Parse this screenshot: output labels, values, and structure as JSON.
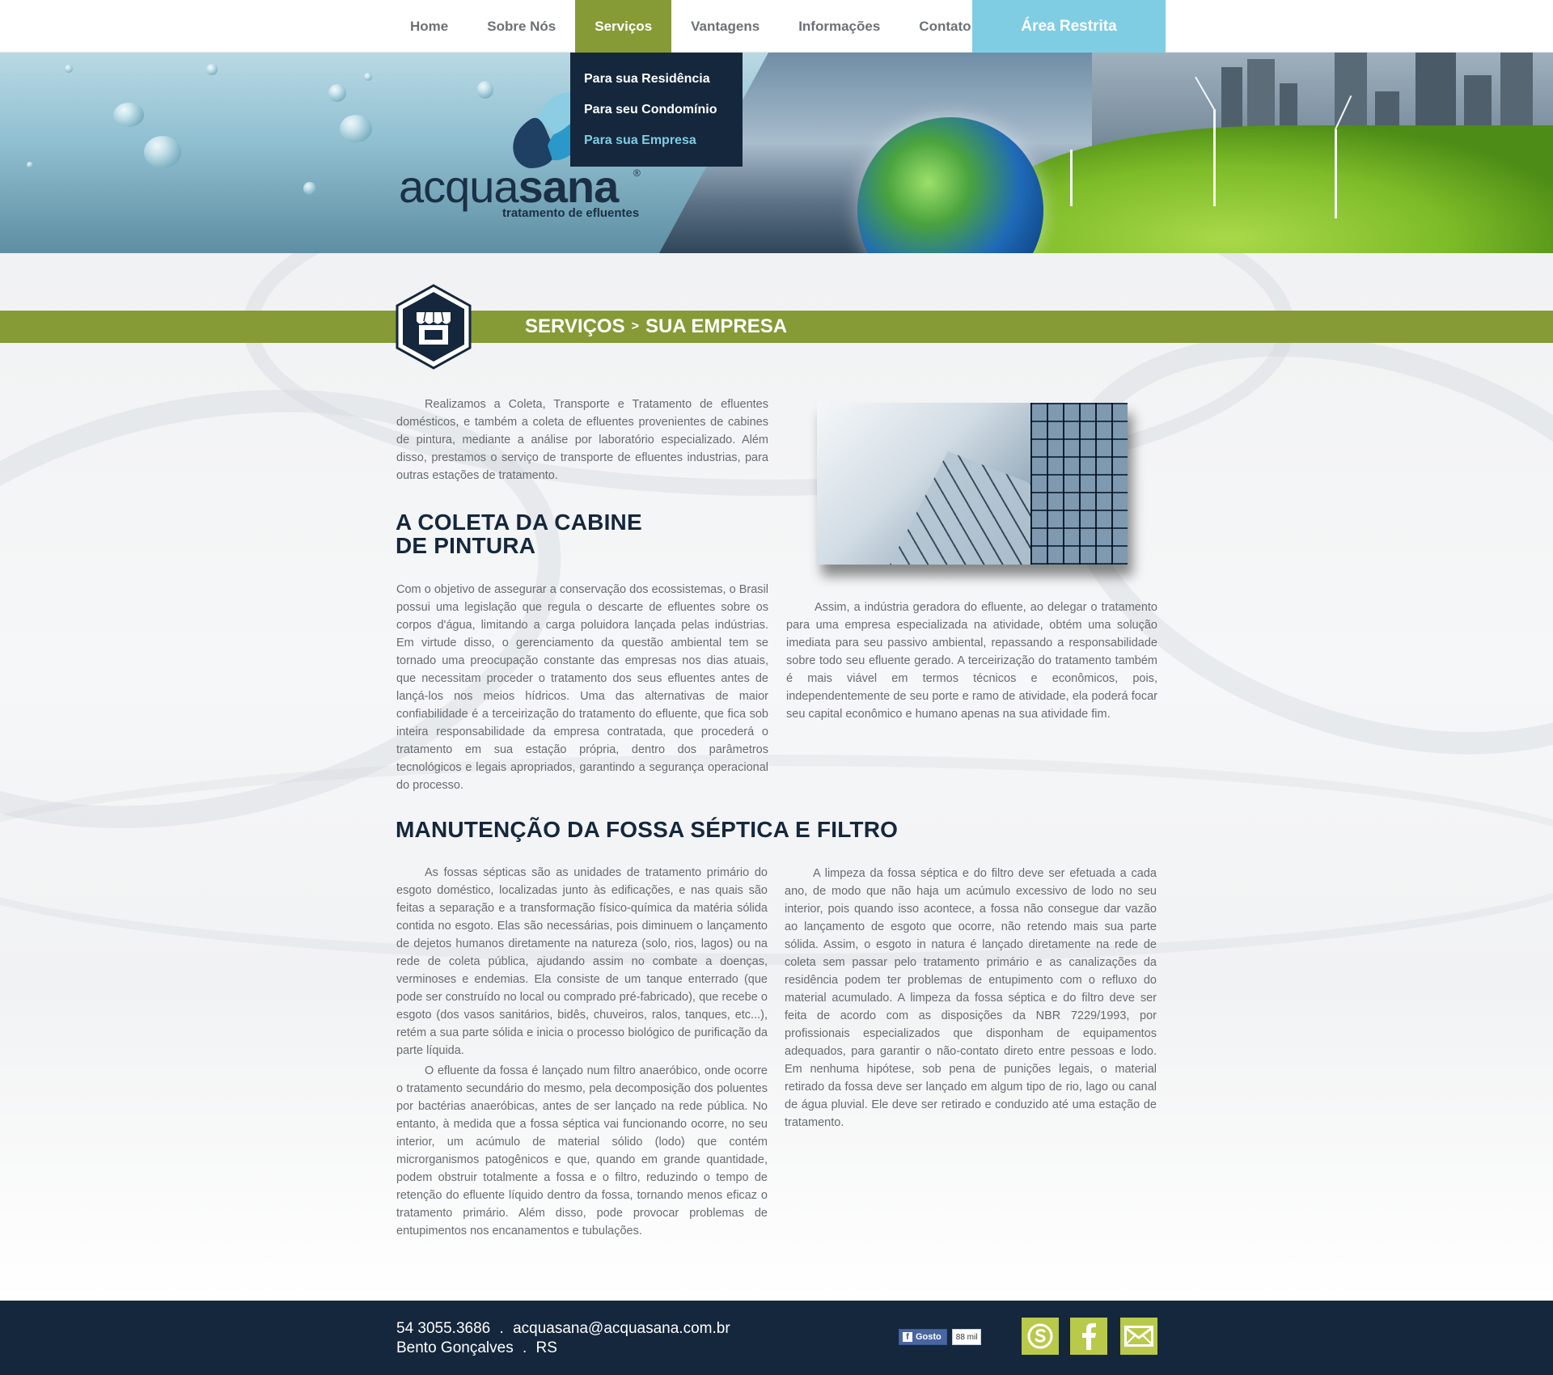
{
  "nav": {
    "items": [
      "Home",
      "Sobre Nós",
      "Serviços",
      "Vantagens",
      "Informações",
      "Contato"
    ],
    "active_index": 2,
    "restrict_label": "Área Restrita"
  },
  "dropdown": {
    "items": [
      "Para sua Residência",
      "Para seu Condomínio",
      "Para sua Empresa"
    ],
    "current_index": 2
  },
  "logo": {
    "name_part1": "acqua",
    "name_part2": "sana",
    "registered": "®",
    "tagline": "tratamento de efluentes"
  },
  "section": {
    "title_main": "SERVIÇOS",
    "separator": ">",
    "title_sub": "SUA EMPRESA"
  },
  "intro_text": "Realizamos a Coleta, Transporte e Tratamento de efluentes domésticos, e também a coleta de efluentes provenientes de cabines de pintura, mediante a análise por laboratório especializado. Além disso, prestamos o serviço de transporte de efluentes industrias, para outras estações de tratamento.",
  "cabine": {
    "heading_line1": "A COLETA DA CABINE",
    "heading_line2": "DE PINTURA",
    "text": "Com o objetivo de assegurar a conservação dos ecossistemas, o Brasil possui uma legislação que regula o descarte de efluentes sobre os corpos d'água, limitando a carga poluidora lançada pelas indústrias. Em virtude disso, o gerenciamento da questão ambiental tem se tornado uma preocupação constante das empresas nos dias atuais, que necessitam proceder o tratamento dos seus efluentes antes de lançá-los nos meios hídricos. Uma das alternativas de maior confiabilidade é a terceirização do tratamento do efluente, que fica sob inteira responsabilidade da empresa contratada, que procederá o tratamento em sua estação própria, dentro dos parâmetros tecnológicos e legais apropriados, garantindo a segurança operacional do processo."
  },
  "right_text": "Assim, a indústria geradora do efluente, ao delegar o tratamento para uma empresa especializada na atividade, obtém uma solução imediata para seu passivo ambiental, repassando a responsabilidade sobre todo seu efluente gerado. A terceirização do tratamento também é mais viável em termos técnicos e econômicos, pois, independentemente de seu porte e ramo de atividade, ela poderá focar seu capital econômico e humano apenas na sua atividade fim.",
  "fossa": {
    "heading": "MANUTENÇÃO DA FOSSA SÉPTICA E FILTRO",
    "left_p1": "As fossas sépticas são as unidades de tratamento primário do esgoto doméstico, localizadas junto às edificações, e nas quais são feitas a separação e a transformação físico-química da matéria sólida contida no esgoto. Elas são necessárias, pois diminuem o lançamento de dejetos humanos diretamente na natureza (solo, rios, lagos) ou na rede de coleta pública, ajudando assim no combate a doenças, verminoses e endemias. Ela consiste de um tanque enterrado (que pode ser construído no local ou comprado pré-fabricado), que recebe o esgoto (dos vasos sanitários, bidês, chuveiros, ralos, tanques, etc...), retém a sua parte sólida e inicia o processo biológico de purificação da parte líquida.",
    "left_p2": "O efluente da fossa é lançado num filtro anaeróbico, onde ocorre o tratamento secundário do mesmo, pela decomposição dos poluentes por bactérias anaeróbicas, antes de ser lançado na rede pública. No entanto, à medida que a fossa séptica vai funcionando ocorre, no seu interior, um acúmulo de material sólido (lodo) que contém microrganismos patogênicos e que, quando em grande quantidade, podem obstruir totalmente a fossa e o filtro, reduzindo o tempo de retenção do efluente líquido dentro da fossa, tornando menos eficaz o tratamento primário. Além disso, pode provocar problemas de entupimentos nos encanamentos e tubulações.",
    "right_p1": "A limpeza da fossa séptica e do filtro deve ser efetuada a cada ano, de modo que não haja um acúmulo excessivo de lodo no seu interior, pois quando isso acontece, a fossa não consegue dar vazão ao lançamento de esgoto que ocorre, não retendo mais sua parte sólida. Assim, o esgoto in natura é lançado diretamente na rede de coleta sem passar pelo tratamento primário e as canalizações da residência podem ter problemas de entupimento com o refluxo do material acumulado. A limpeza da fossa séptica e do filtro deve ser feita de acordo com as disposições da NBR 7229/1993, por profissionais especializados que disponham de equipamentos adequados, para garantir o não-contato direto entre pessoas e lodo. Em nenhuma hipótese, sob pena de punições legais, o material retirado da fossa deve ser lançado em algum tipo de rio, lago ou canal de água pluvial. Ele deve ser retirado e conduzido até uma estação de tratamento."
  },
  "footer": {
    "phone": "54 3055.3686",
    "dot": ".",
    "email": "acquasana@acquasana.com.br",
    "city": "Bento Gonçalves",
    "state": "RS",
    "fb_like_label": "Gosto",
    "fb_like_count": "88 mil"
  },
  "icons": {
    "section": "storefront-icon",
    "social": [
      "skype-icon",
      "facebook-icon",
      "mail-icon"
    ]
  },
  "colors": {
    "green": "#869a36",
    "navy": "#15273d",
    "light_blue": "#7fcde3",
    "social_green": "#b9c94a"
  }
}
